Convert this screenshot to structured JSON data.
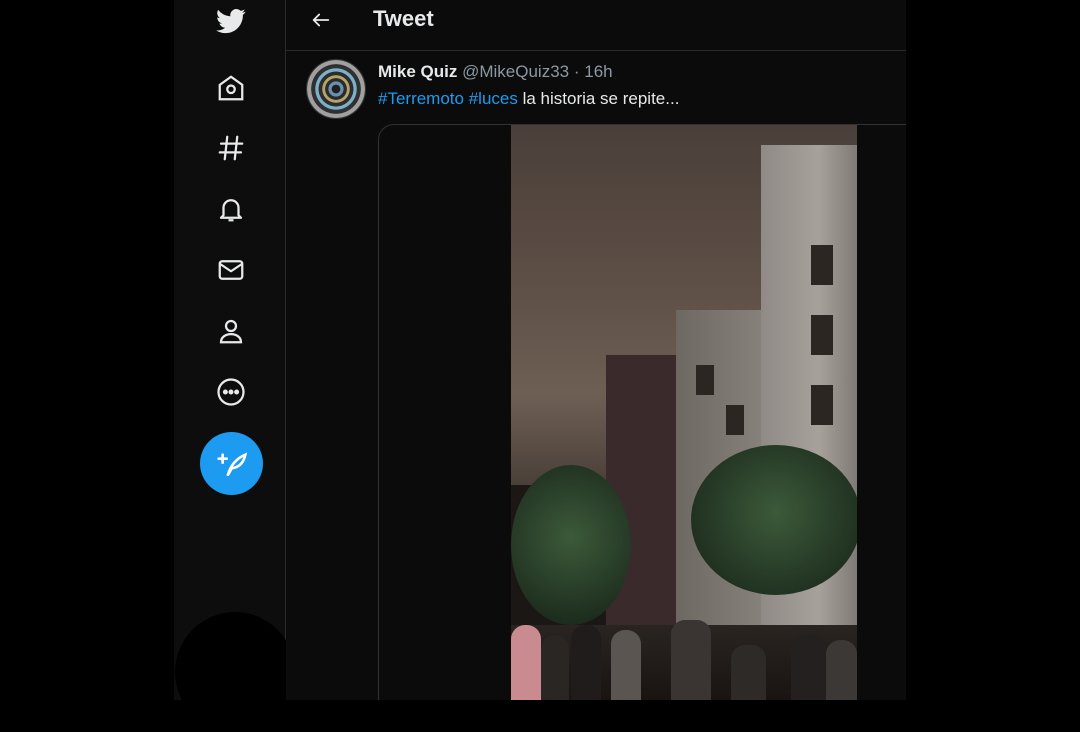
{
  "header": {
    "title": "Tweet"
  },
  "nav": {
    "logo_icon": "twitter-bird-icon",
    "items": [
      {
        "icon": "home-icon"
      },
      {
        "icon": "hashtag-icon"
      },
      {
        "icon": "bell-icon"
      },
      {
        "icon": "mail-icon"
      },
      {
        "icon": "person-icon"
      },
      {
        "icon": "more-icon"
      }
    ],
    "compose_icon": "compose-feather-icon",
    "accent": "#1d9bf0"
  },
  "tweet": {
    "author_name": "Mike Quiz",
    "author_handle": "@MikeQuiz33",
    "separator": "·",
    "time": "16h",
    "hashtag1": "#Terremoto",
    "hashtag2": "#luces",
    "text": " la historia se repite..."
  }
}
